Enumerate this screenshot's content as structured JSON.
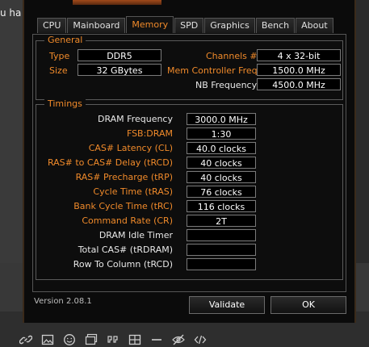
{
  "background": {
    "partial_text": "u ha"
  },
  "window": {
    "tabs": [
      {
        "label": "CPU",
        "active": false
      },
      {
        "label": "Mainboard",
        "active": false
      },
      {
        "label": "Memory",
        "active": true
      },
      {
        "label": "SPD",
        "active": false
      },
      {
        "label": "Graphics",
        "active": false
      },
      {
        "label": "Bench",
        "active": false
      },
      {
        "label": "About",
        "active": false
      }
    ],
    "general": {
      "title": "General",
      "type_label": "Type",
      "type_value": "DDR5",
      "size_label": "Size",
      "size_value": "32 GBytes",
      "channels_label": "Channels #",
      "channels_value": "4 x 32-bit",
      "mem_ctrl_label": "Mem Controller Freq.",
      "mem_ctrl_value": "1500.0 MHz",
      "nb_freq_label": "NB Frequency",
      "nb_freq_value": "4500.0 MHz"
    },
    "timings": {
      "title": "Timings",
      "rows": [
        {
          "label": "DRAM Frequency",
          "value": "3000.0 MHz",
          "color": "white"
        },
        {
          "label": "FSB:DRAM",
          "value": "1:30",
          "color": "orange"
        },
        {
          "label": "CAS# Latency (CL)",
          "value": "40.0 clocks",
          "color": "orange"
        },
        {
          "label": "RAS# to CAS# Delay (tRCD)",
          "value": "40 clocks",
          "color": "orange"
        },
        {
          "label": "RAS# Precharge (tRP)",
          "value": "40 clocks",
          "color": "orange"
        },
        {
          "label": "Cycle Time (tRAS)",
          "value": "76 clocks",
          "color": "orange"
        },
        {
          "label": "Bank Cycle Time (tRC)",
          "value": "116 clocks",
          "color": "orange"
        },
        {
          "label": "Command Rate (CR)",
          "value": "2T",
          "color": "orange"
        },
        {
          "label": "DRAM Idle Timer",
          "value": "",
          "color": "white"
        },
        {
          "label": "Total CAS# (tRDRAM)",
          "value": "",
          "color": "white"
        },
        {
          "label": "Row To Column (tRCD)",
          "value": "",
          "color": "white"
        }
      ]
    },
    "version": "Version 2.08.1",
    "validate_label": "Validate",
    "ok_label": "OK"
  },
  "toolbar_icons": [
    "link-icon",
    "image-icon",
    "emoji-icon",
    "gallery-icon",
    "quote-icon",
    "table-icon",
    "horizontal-rule-icon",
    "hide-icon",
    "code-icon"
  ],
  "colors": {
    "accent": "#f08a2a",
    "window_bg": "#0b0b0b",
    "field_bg": "#000000"
  }
}
